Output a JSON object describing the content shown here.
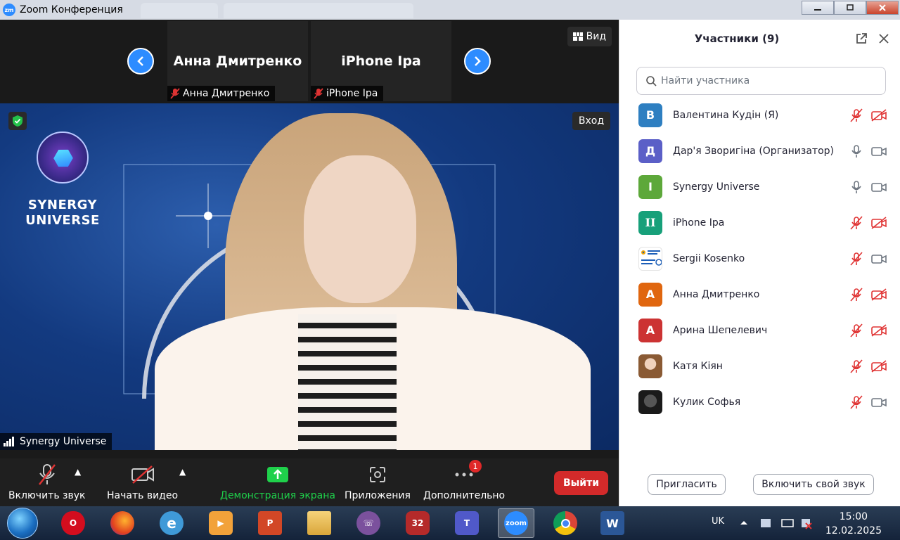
{
  "window": {
    "title": "Zoom Конференция",
    "app_icon": "zm",
    "minimize_icon": "minimize-icon",
    "maximize_icon": "maximize-icon",
    "close_icon": "close-icon"
  },
  "thumbnails": [
    {
      "name": "Анна Дмитренко",
      "label": "Анна Дмитренко",
      "muted": true
    },
    {
      "name": "iPhone Ipa",
      "label": "iPhone Ipa",
      "muted": true
    }
  ],
  "view_button": "Вид",
  "main_video": {
    "enter_button": "Вход",
    "brand_line1": "SYNERGY",
    "brand_line2": "UNIVERSE",
    "speaker_label": "Synergy Universe"
  },
  "toolbar": {
    "unmute": "Включить звук",
    "start_video": "Начать видео",
    "share_screen": "Демонстрация экрана",
    "apps": "Приложения",
    "more": "Дополнительно",
    "more_badge": "1",
    "leave": "Выйти"
  },
  "panel": {
    "title": "Участники (9)",
    "search_placeholder": "Найти участника",
    "participants": [
      {
        "initial": "В",
        "name": "Валентина Кудін (Я)",
        "color": "#2e7fc1",
        "mic_muted": true,
        "video_off": true
      },
      {
        "initial": "Д",
        "name": "Дар'я Зворигіна (Организатор)",
        "color": "#5b5fc7",
        "mic_muted": false,
        "video_off": false
      },
      {
        "initial": "I",
        "name": "Synergy Universe",
        "color": "#5da83a",
        "mic_muted": false,
        "video_off": false
      },
      {
        "initial": "II",
        "name": "iPhone Ipa",
        "color": "#17a07a",
        "mic_muted": true,
        "video_off": true
      },
      {
        "initial": "",
        "name": "Sergii Kosenko",
        "color": "#ffffff",
        "mic_muted": true,
        "video_off": false
      },
      {
        "initial": "А",
        "name": "Анна Дмитренко",
        "color": "#e0660f",
        "mic_muted": true,
        "video_off": true
      },
      {
        "initial": "А",
        "name": "Арина Шепелевич",
        "color": "#cc3333",
        "mic_muted": true,
        "video_off": true
      },
      {
        "initial": "",
        "name": "Катя Кіян",
        "color": "#b48a62",
        "mic_muted": true,
        "video_off": true
      },
      {
        "initial": "",
        "name": "Кулик Софья",
        "color": "#2b2b2b",
        "mic_muted": true,
        "video_off": false
      }
    ],
    "invite": "Пригласить",
    "unmute_me": "Включить свой звук"
  },
  "taskbar": {
    "apps": [
      "opera",
      "firefox",
      "internet-explorer",
      "media-player",
      "powerpoint",
      "file-explorer",
      "viber",
      "game-32",
      "teams",
      "zoom",
      "chrome",
      "word"
    ],
    "badge_game": "32",
    "zoom_label": "zoom",
    "lang": "UK",
    "time": "15:00",
    "date": "12.02.2025"
  }
}
